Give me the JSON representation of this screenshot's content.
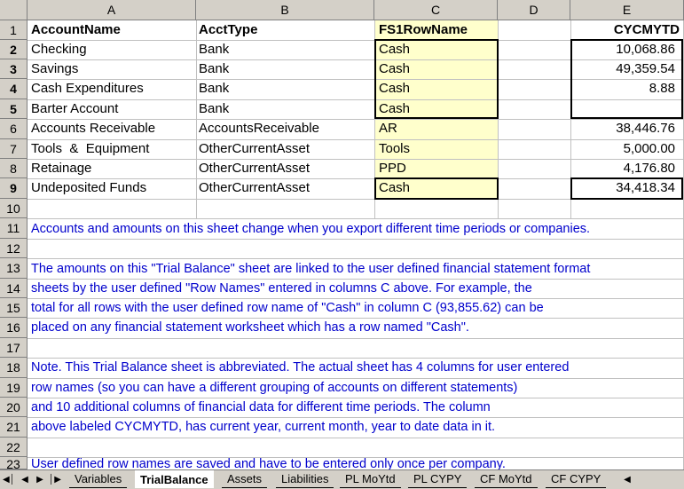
{
  "columns": [
    "A",
    "B",
    "C",
    "D",
    "E"
  ],
  "rows": [
    "1",
    "2",
    "3",
    "4",
    "5",
    "6",
    "7",
    "8",
    "9",
    "10",
    "11",
    "12",
    "13",
    "14",
    "15",
    "16",
    "17",
    "18",
    "19",
    "20",
    "21",
    "22",
    "23"
  ],
  "headers": {
    "a": "AccountName",
    "b": "AcctType",
    "c": "FS1RowName",
    "e": "CYCMYTD"
  },
  "data_rows": [
    {
      "name": "Checking",
      "type": "Bank",
      "row": "Cash",
      "amount": "10,068.86"
    },
    {
      "name": "Savings",
      "type": "Bank",
      "row": "Cash",
      "amount": "49,359.54"
    },
    {
      "name": "Cash Expenditures",
      "type": "Bank",
      "row": "Cash",
      "amount": "8.88"
    },
    {
      "name": "Barter Account",
      "type": "Bank",
      "row": "Cash",
      "amount": ""
    },
    {
      "name": "Accounts Receivable",
      "type": "AccountsReceivable",
      "row": "AR",
      "amount": "38,446.76"
    },
    {
      "name": "Tools  &  Equipment",
      "type": "OtherCurrentAsset",
      "row": "Tools",
      "amount": "5,000.00"
    },
    {
      "name": "Retainage",
      "type": "OtherCurrentAsset",
      "row": "PPD",
      "amount": "4,176.80"
    },
    {
      "name": "Undeposited Funds",
      "type": "OtherCurrentAsset",
      "row": "Cash",
      "amount": "34,418.34"
    }
  ],
  "notes": {
    "r11": "Accounts and amounts on this sheet change when you export different time periods or companies.",
    "r13": "The amounts on this \"Trial Balance\" sheet are linked to the user defined financial statement format",
    "r14": "sheets by the user defined \"Row Names\" entered in columns C above. For example, the",
    "r15": "total for all rows with the user defined row name of \"Cash\" in column C (93,855.62) can be",
    "r16": "placed on any financial statement worksheet which has a row named \"Cash\".",
    "r18": "Note. This Trial Balance sheet is abbreviated. The actual sheet has 4 columns for user entered",
    "r19": "row names (so you can have a different grouping of accounts on different statements)",
    "r20": "and 10 additional columns of financial data for different time periods. The column",
    "r21": "above labeled CYCMYTD, has current year, current month, year to date data in it.",
    "r23": "User defined row names are saved and have to be entered only once per company."
  },
  "tabs": [
    "Variables",
    "TrialBalance",
    "Assets",
    "Liabilities",
    "PL MoYtd",
    "PL CYPY",
    "CF MoYtd",
    "CF CYPY"
  ],
  "active_tab": "TrialBalance",
  "colors": {
    "highlight": "#ffffcc",
    "note_text": "#0000cc",
    "chrome": "#d4d0c8"
  }
}
